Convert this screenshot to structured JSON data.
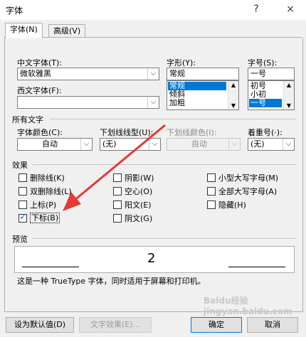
{
  "window": {
    "title": "字体",
    "help": "?",
    "close": "×"
  },
  "tabs": [
    {
      "label": "字体(N)"
    },
    {
      "label": "高级(V)"
    }
  ],
  "chinese_font": {
    "label": "中文字体(T):",
    "value": "微软雅黑"
  },
  "western_font": {
    "label": "西文字体(F):",
    "value": ""
  },
  "style": {
    "label": "字形(Y):",
    "value": "常规",
    "options": [
      "常规",
      "倾斜",
      "加粗"
    ],
    "selected": "常规"
  },
  "size": {
    "label": "字号(S):",
    "value": "一号",
    "options": [
      "初号",
      "小初",
      "一号"
    ],
    "selected": "一号"
  },
  "all_text": {
    "title": "所有文字",
    "font_color": {
      "label": "字体颜色(C):",
      "value": "自动"
    },
    "underline_type": {
      "label": "下划线线型(U):",
      "value": "(无)"
    },
    "underline_color": {
      "label": "下划线颜色(I):",
      "value": "自动"
    },
    "emphasis": {
      "label": "着重号(·):",
      "value": "(无)"
    }
  },
  "effects": {
    "title": "效果",
    "items": [
      {
        "label": "删除线(K)",
        "checked": false
      },
      {
        "label": "双删除线(L)",
        "checked": false
      },
      {
        "label": "上标(P)",
        "checked": false
      },
      {
        "label": "下标(B)",
        "checked": true
      },
      {
        "label": "阴影(W)",
        "checked": false
      },
      {
        "label": "空心(O)",
        "checked": false
      },
      {
        "label": "阳文(E)",
        "checked": false
      },
      {
        "label": "阴文(G)",
        "checked": false
      },
      {
        "label": "小型大写字母(M)",
        "checked": false
      },
      {
        "label": "全部大写字母(A)",
        "checked": false
      },
      {
        "label": "隐藏(H)",
        "checked": false
      }
    ]
  },
  "preview": {
    "title": "预览",
    "sample": "2",
    "note": "这是一种 TrueType 字体，同时适用于屏幕和打印机。"
  },
  "buttons": {
    "set_default": "设为默认值(D)",
    "text_effects": "文字效果(E)...",
    "ok": "确定",
    "cancel": "取消"
  },
  "watermark": "Baidu经验 jingyan.baidu.com",
  "colors": {
    "accent": "#0078d7",
    "arrow": "#e53935"
  }
}
